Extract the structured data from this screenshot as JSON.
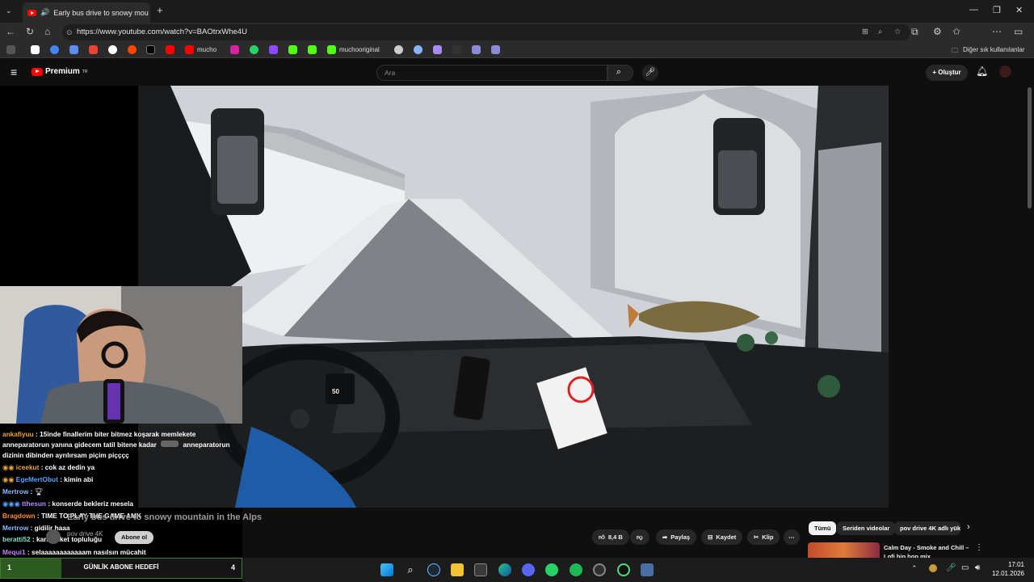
{
  "browser": {
    "tab_title": "Early bus drive to snowy mou",
    "url": "https://www.youtube.com/watch?v=BAOtrxWhe4U",
    "bookmarks": [
      {
        "label": "mucho",
        "color": "#ff0000"
      },
      {
        "label": "muchooriginal",
        "color": "#53fc18"
      }
    ],
    "other_bookmarks": "Diğer sık kullanılanlar"
  },
  "youtube": {
    "logo_text": "Premium",
    "region": "TR",
    "search_placeholder": "Ara",
    "create_label": "Oluştur",
    "video_title": "Early bus drive to snowy mountain in the Alps",
    "channel_name": "pov drive 4K",
    "subscribe_label": "Abone ol",
    "like_count": "8,4 B",
    "share_label": "Paylaş",
    "save_label": "Kaydet",
    "clip_label": "Klip",
    "chips": [
      "Tümü",
      "Seriden videolar",
      "pov drive 4K adlı yük"
    ],
    "rec_title_line1": "Calm Day - Smoke and Chill –",
    "rec_title_line2": "Lofi hip hop mix"
  },
  "dashboard": {
    "speed": "50"
  },
  "stream": {
    "chat": [
      {
        "user": "ankafiyuu",
        "color": "#f1a33c",
        "message": "15inde finallerim biter bitmez koşarak memlekete",
        "line2": "anneparatorun yanına gidecem tatil bitene kadar",
        "tail": "anneparatorun",
        "line3": "dizinin dibinden ayrılırsam piçim piçççç"
      },
      {
        "user": "iceekut",
        "color": "#f1a33c",
        "message": "cok az dedin ya"
      },
      {
        "user": "EgeMertObut",
        "color": "#5aa2ff",
        "message": "kimin abi"
      },
      {
        "user": "Mertrow",
        "color": "#8fb8ff",
        "message": ""
      },
      {
        "user": "tthesun",
        "color": "#b48cff",
        "message": "konserde bekleriz mesela"
      },
      {
        "user": "Bragdown",
        "color": "#ff8a3c",
        "message": "TIME TO PLAY THE GAME AMK"
      },
      {
        "user": "Mertrow",
        "color": "#8fb8ff",
        "message": "gidilir haaa"
      },
      {
        "user": "beratti52",
        "color": "#7ee0d0",
        "message": "kara etiket topluluğu"
      },
      {
        "user": "Mequi1",
        "color": "#c77dff",
        "message": "selaaaaaaaaaaaam nasılsın mücahit"
      }
    ],
    "goal": {
      "label": "GÜNLİK ABONE HEDEFİ",
      "current": "1",
      "target": "4",
      "progress": 0.25
    }
  },
  "taskbar": {
    "time": "17:01",
    "date": "12.01.2026"
  }
}
